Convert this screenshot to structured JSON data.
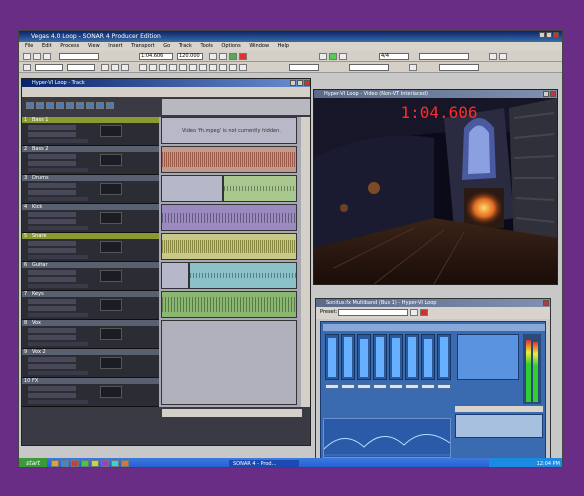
{
  "app": {
    "title": "Vegas 4.0 Loop - SONAR 4 Producer Edition"
  },
  "menu": [
    "File",
    "Edit",
    "Process",
    "View",
    "Insert",
    "Transport",
    "Go",
    "Track",
    "Tools",
    "Options",
    "Window",
    "Help"
  ],
  "toolbar": {
    "time_field": "1:04.606",
    "tempo_field": "120.000",
    "measure_field": "4/4"
  },
  "track_window": {
    "title": "Hyper-VI Loop - Track",
    "message": "Video 'fh.mpeg' is not currently hidden.",
    "tracks": [
      {
        "num": "1",
        "name": "Bass 1"
      },
      {
        "num": "2",
        "name": "Bass 2"
      },
      {
        "num": "3",
        "name": "Drums"
      },
      {
        "num": "4",
        "name": "Kick"
      },
      {
        "num": "5",
        "name": "Snare"
      },
      {
        "num": "6",
        "name": "Guitar"
      },
      {
        "num": "7",
        "name": "Keys"
      },
      {
        "num": "8",
        "name": "Vox"
      },
      {
        "num": "9",
        "name": "Vox 2"
      },
      {
        "num": "10",
        "name": "FX"
      }
    ]
  },
  "video_window": {
    "title": "Hyper-VI Loop - Video (Non-VT Interlaced)",
    "timecode": "1:04.606"
  },
  "mixer_window": {
    "title": "Sonitus:fx Multiband (Bus 1) - Hyper-VI Loop",
    "preset_label": "Preset:",
    "strip_levels": [
      0.88,
      0.9,
      0.86,
      0.92,
      0.89,
      0.91,
      0.87,
      0.9
    ],
    "colors": {
      "accent": "#2a5a9c",
      "meter": "#66b0ff"
    }
  },
  "taskbar": {
    "start": "start",
    "task": "SONAR 4 - Prod...",
    "clock": "12:04 PM"
  },
  "colors": {
    "desktop": "#6a2d86",
    "timecode": "#ff2a2a",
    "title_bar": "#0a246a"
  }
}
